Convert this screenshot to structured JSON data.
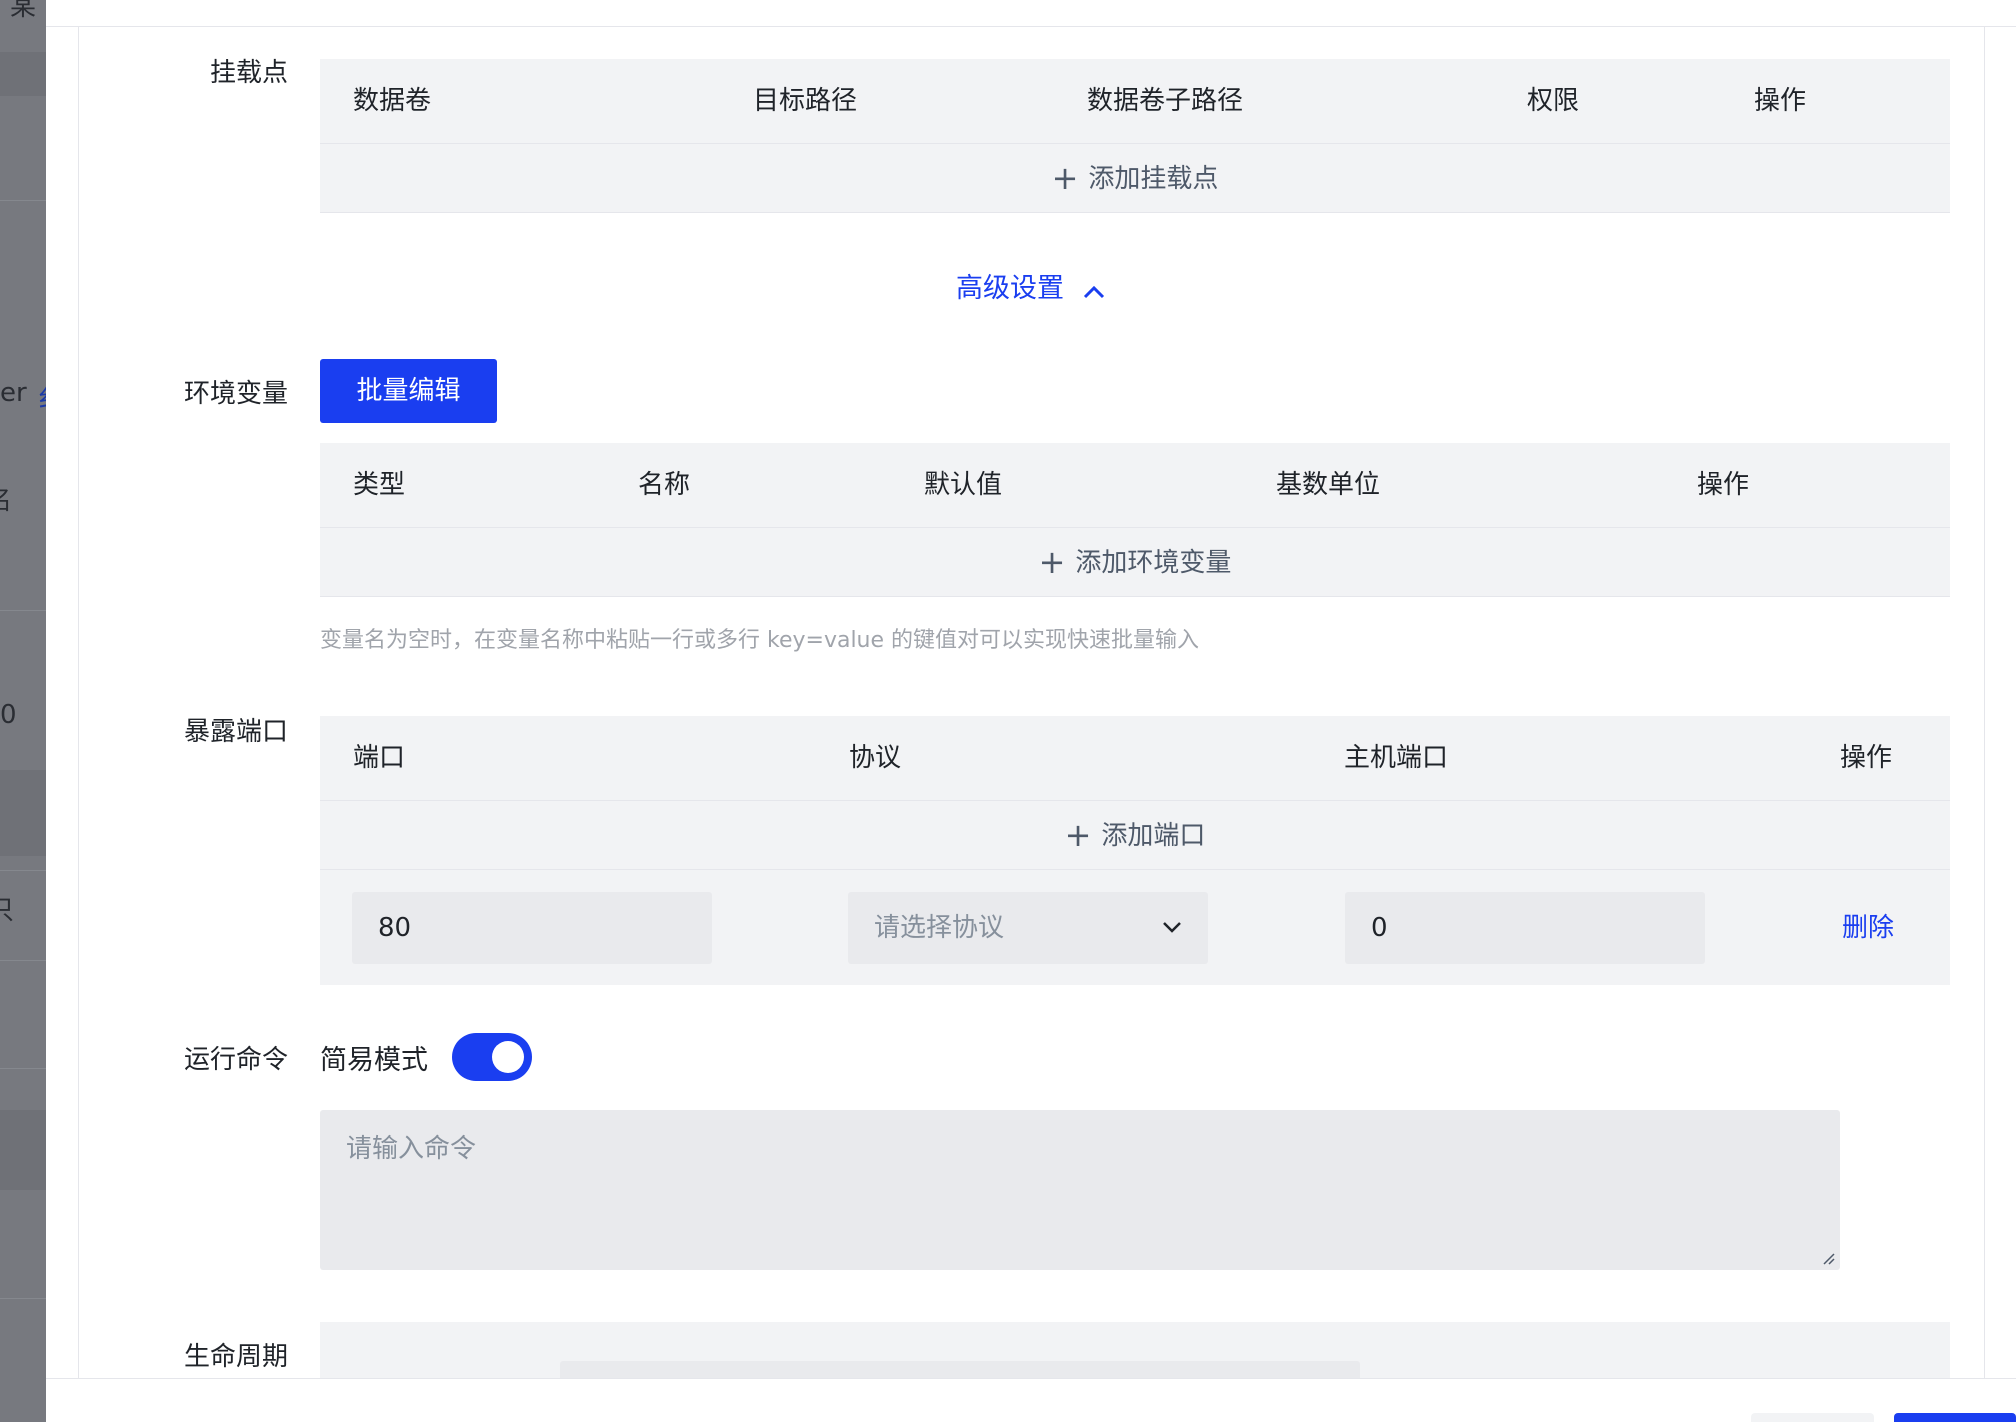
{
  "background": {
    "fragments": [
      "某",
      "er",
      "纟",
      "名",
      "0",
      "只"
    ]
  },
  "mounts": {
    "label": "挂载点",
    "columns": [
      "数据卷",
      "目标路径",
      "数据卷子路径",
      "权限",
      "操作"
    ],
    "add_label": "添加挂载点"
  },
  "advanced": {
    "label": "高级设置",
    "icon": "chevron-up-icon"
  },
  "env": {
    "label": "环境变量",
    "batch_edit_label": "批量编辑",
    "columns": [
      "类型",
      "名称",
      "默认值",
      "基数单位",
      "操作"
    ],
    "add_label": "添加环境变量",
    "hint": "变量名为空时，在变量名称中粘贴一行或多行 key=value 的键值对可以实现快速批量输入"
  },
  "ports": {
    "label": "暴露端口",
    "columns": [
      "端口",
      "协议",
      "主机端口",
      "操作"
    ],
    "add_label": "添加端口",
    "row": {
      "port": "80",
      "protocol_placeholder": "请选择协议",
      "host_port": "0",
      "delete_label": "删除"
    }
  },
  "command": {
    "label": "运行命令",
    "simple_mode_label": "简易模式",
    "simple_mode_on": true,
    "placeholder": "请输入命令"
  },
  "lifecycle": {
    "label": "生命周期"
  },
  "colors": {
    "primary": "#1a3ef0",
    "table_bg": "#f2f3f5",
    "input_bg": "#e9eaed"
  }
}
